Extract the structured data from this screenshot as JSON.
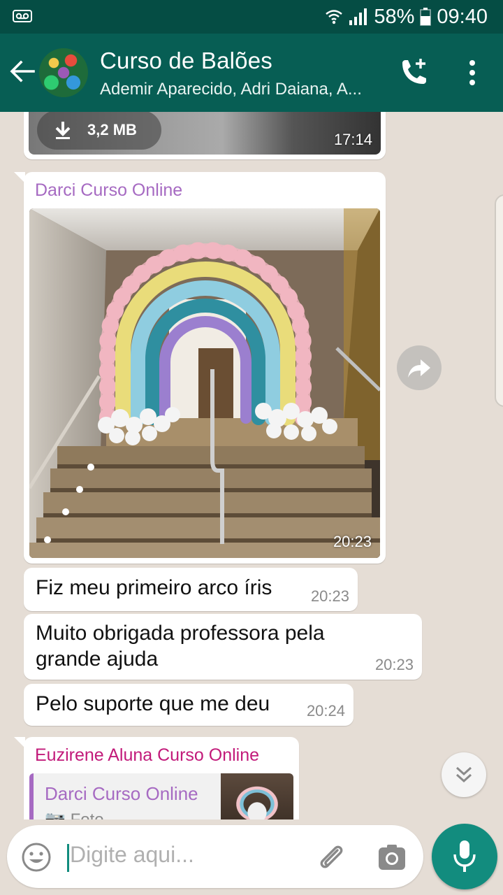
{
  "status_bar": {
    "battery": "58%",
    "time": "09:40"
  },
  "header": {
    "title": "Curso de Balões",
    "subtitle": "Ademir Aparecido, Adri Daiana, A..."
  },
  "messages": {
    "media_top": {
      "size": "3,2 MB",
      "time": "17:14"
    },
    "image_message": {
      "sender": "Darci Curso Online",
      "time": "20:23"
    },
    "text1": {
      "text": "Fiz meu primeiro arco íris",
      "time": "20:23"
    },
    "text2": {
      "line1": "Muito obrigada professora pela",
      "line2": "grande ajuda",
      "time": "20:23"
    },
    "text3": {
      "text": "Pelo suporte que me deu",
      "time": "20:24"
    },
    "reply_message": {
      "sender": "Euzirene Aluna Curso Online",
      "quoted_sender": "Darci Curso Online",
      "quoted_type": "Foto"
    }
  },
  "composer": {
    "placeholder": "Digite aqui..."
  },
  "colors": {
    "app_bar": "#075e54",
    "status_bar": "#054d44",
    "accent": "#128c7e",
    "chat_bg": "#e5ddd5"
  }
}
